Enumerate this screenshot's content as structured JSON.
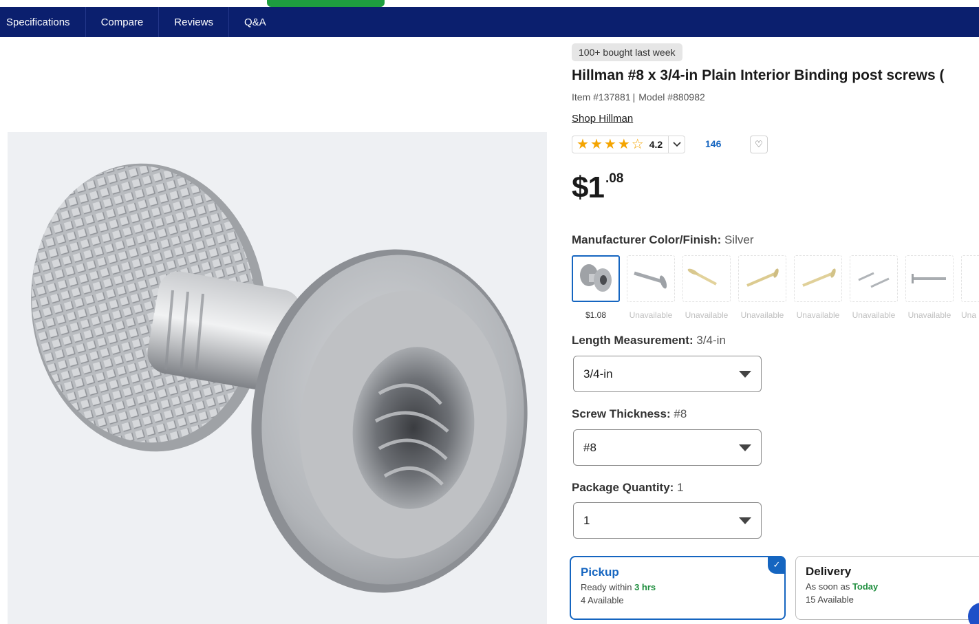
{
  "nav": {
    "tabs": [
      "Specifications",
      "Compare",
      "Reviews",
      "Q&A"
    ]
  },
  "product": {
    "badge": "100+ bought last week",
    "title": "Hillman #8 x 3/4-in Plain Interior Binding post screws (",
    "item_number": "Item #137881",
    "model_number": "Model #880982",
    "shop_link": "Shop Hillman",
    "rating": {
      "stars_filled": 4,
      "stars_total": 5,
      "value": "4.2",
      "review_count": "146"
    },
    "price": {
      "dollars": "$1",
      "cents": ".08"
    }
  },
  "options": {
    "color_finish": {
      "label": "Manufacturer Color/Finish:",
      "value": "Silver",
      "swatches": [
        {
          "caption": "$1.08",
          "selected": true
        },
        {
          "caption": "Unavailable",
          "selected": false
        },
        {
          "caption": "Unavailable",
          "selected": false
        },
        {
          "caption": "Unavailable",
          "selected": false
        },
        {
          "caption": "Unavailable",
          "selected": false
        },
        {
          "caption": "Unavailable",
          "selected": false
        },
        {
          "caption": "Unavailable",
          "selected": false
        },
        {
          "caption": "Una",
          "selected": false
        }
      ]
    },
    "length": {
      "label": "Length Measurement:",
      "value": "3/4-in",
      "selected": "3/4-in"
    },
    "thickness": {
      "label": "Screw Thickness:",
      "value": "#8",
      "selected": "#8"
    },
    "package_qty": {
      "label": "Package Quantity:",
      "value": "1",
      "selected": "1"
    }
  },
  "fulfillment": {
    "pickup": {
      "title": "Pickup",
      "ready_prefix": "Ready within",
      "ready_time": "3 hrs",
      "available": "4 Available"
    },
    "delivery": {
      "title": "Delivery",
      "soon_prefix": "As soon as",
      "soon_time": "Today",
      "available": "15 Available"
    }
  },
  "colors": {
    "nav_bg": "#0b1f6e",
    "accent_blue": "#1565c0",
    "star": "#f4a400",
    "green": "#1e8e3e"
  }
}
